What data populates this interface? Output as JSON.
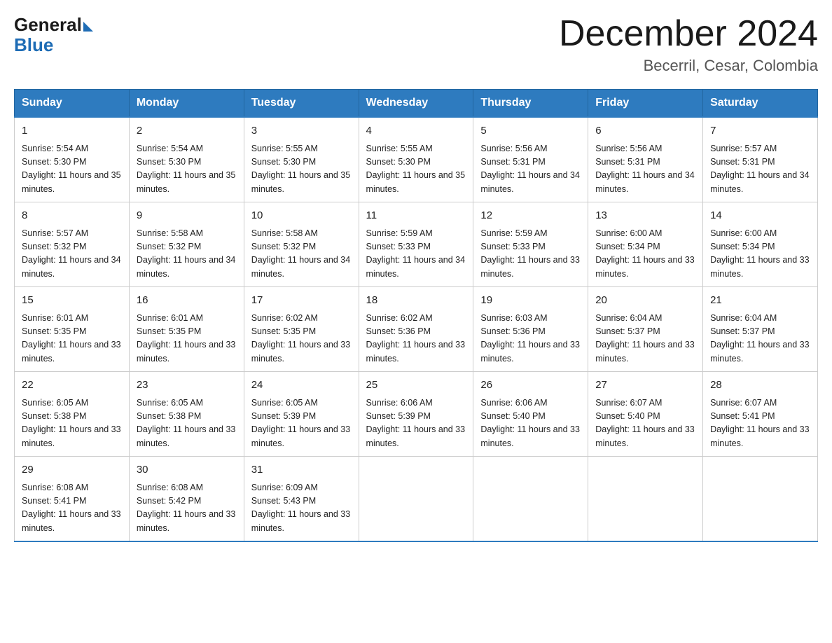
{
  "header": {
    "logo_general": "General",
    "logo_blue": "Blue",
    "month_title": "December 2024",
    "location": "Becerril, Cesar, Colombia"
  },
  "days_of_week": [
    "Sunday",
    "Monday",
    "Tuesday",
    "Wednesday",
    "Thursday",
    "Friday",
    "Saturday"
  ],
  "weeks": [
    [
      {
        "day": "1",
        "sunrise": "5:54 AM",
        "sunset": "5:30 PM",
        "daylight": "11 hours and 35 minutes."
      },
      {
        "day": "2",
        "sunrise": "5:54 AM",
        "sunset": "5:30 PM",
        "daylight": "11 hours and 35 minutes."
      },
      {
        "day": "3",
        "sunrise": "5:55 AM",
        "sunset": "5:30 PM",
        "daylight": "11 hours and 35 minutes."
      },
      {
        "day": "4",
        "sunrise": "5:55 AM",
        "sunset": "5:30 PM",
        "daylight": "11 hours and 35 minutes."
      },
      {
        "day": "5",
        "sunrise": "5:56 AM",
        "sunset": "5:31 PM",
        "daylight": "11 hours and 34 minutes."
      },
      {
        "day": "6",
        "sunrise": "5:56 AM",
        "sunset": "5:31 PM",
        "daylight": "11 hours and 34 minutes."
      },
      {
        "day": "7",
        "sunrise": "5:57 AM",
        "sunset": "5:31 PM",
        "daylight": "11 hours and 34 minutes."
      }
    ],
    [
      {
        "day": "8",
        "sunrise": "5:57 AM",
        "sunset": "5:32 PM",
        "daylight": "11 hours and 34 minutes."
      },
      {
        "day": "9",
        "sunrise": "5:58 AM",
        "sunset": "5:32 PM",
        "daylight": "11 hours and 34 minutes."
      },
      {
        "day": "10",
        "sunrise": "5:58 AM",
        "sunset": "5:32 PM",
        "daylight": "11 hours and 34 minutes."
      },
      {
        "day": "11",
        "sunrise": "5:59 AM",
        "sunset": "5:33 PM",
        "daylight": "11 hours and 34 minutes."
      },
      {
        "day": "12",
        "sunrise": "5:59 AM",
        "sunset": "5:33 PM",
        "daylight": "11 hours and 33 minutes."
      },
      {
        "day": "13",
        "sunrise": "6:00 AM",
        "sunset": "5:34 PM",
        "daylight": "11 hours and 33 minutes."
      },
      {
        "day": "14",
        "sunrise": "6:00 AM",
        "sunset": "5:34 PM",
        "daylight": "11 hours and 33 minutes."
      }
    ],
    [
      {
        "day": "15",
        "sunrise": "6:01 AM",
        "sunset": "5:35 PM",
        "daylight": "11 hours and 33 minutes."
      },
      {
        "day": "16",
        "sunrise": "6:01 AM",
        "sunset": "5:35 PM",
        "daylight": "11 hours and 33 minutes."
      },
      {
        "day": "17",
        "sunrise": "6:02 AM",
        "sunset": "5:35 PM",
        "daylight": "11 hours and 33 minutes."
      },
      {
        "day": "18",
        "sunrise": "6:02 AM",
        "sunset": "5:36 PM",
        "daylight": "11 hours and 33 minutes."
      },
      {
        "day": "19",
        "sunrise": "6:03 AM",
        "sunset": "5:36 PM",
        "daylight": "11 hours and 33 minutes."
      },
      {
        "day": "20",
        "sunrise": "6:04 AM",
        "sunset": "5:37 PM",
        "daylight": "11 hours and 33 minutes."
      },
      {
        "day": "21",
        "sunrise": "6:04 AM",
        "sunset": "5:37 PM",
        "daylight": "11 hours and 33 minutes."
      }
    ],
    [
      {
        "day": "22",
        "sunrise": "6:05 AM",
        "sunset": "5:38 PM",
        "daylight": "11 hours and 33 minutes."
      },
      {
        "day": "23",
        "sunrise": "6:05 AM",
        "sunset": "5:38 PM",
        "daylight": "11 hours and 33 minutes."
      },
      {
        "day": "24",
        "sunrise": "6:05 AM",
        "sunset": "5:39 PM",
        "daylight": "11 hours and 33 minutes."
      },
      {
        "day": "25",
        "sunrise": "6:06 AM",
        "sunset": "5:39 PM",
        "daylight": "11 hours and 33 minutes."
      },
      {
        "day": "26",
        "sunrise": "6:06 AM",
        "sunset": "5:40 PM",
        "daylight": "11 hours and 33 minutes."
      },
      {
        "day": "27",
        "sunrise": "6:07 AM",
        "sunset": "5:40 PM",
        "daylight": "11 hours and 33 minutes."
      },
      {
        "day": "28",
        "sunrise": "6:07 AM",
        "sunset": "5:41 PM",
        "daylight": "11 hours and 33 minutes."
      }
    ],
    [
      {
        "day": "29",
        "sunrise": "6:08 AM",
        "sunset": "5:41 PM",
        "daylight": "11 hours and 33 minutes."
      },
      {
        "day": "30",
        "sunrise": "6:08 AM",
        "sunset": "5:42 PM",
        "daylight": "11 hours and 33 minutes."
      },
      {
        "day": "31",
        "sunrise": "6:09 AM",
        "sunset": "5:43 PM",
        "daylight": "11 hours and 33 minutes."
      },
      null,
      null,
      null,
      null
    ]
  ]
}
